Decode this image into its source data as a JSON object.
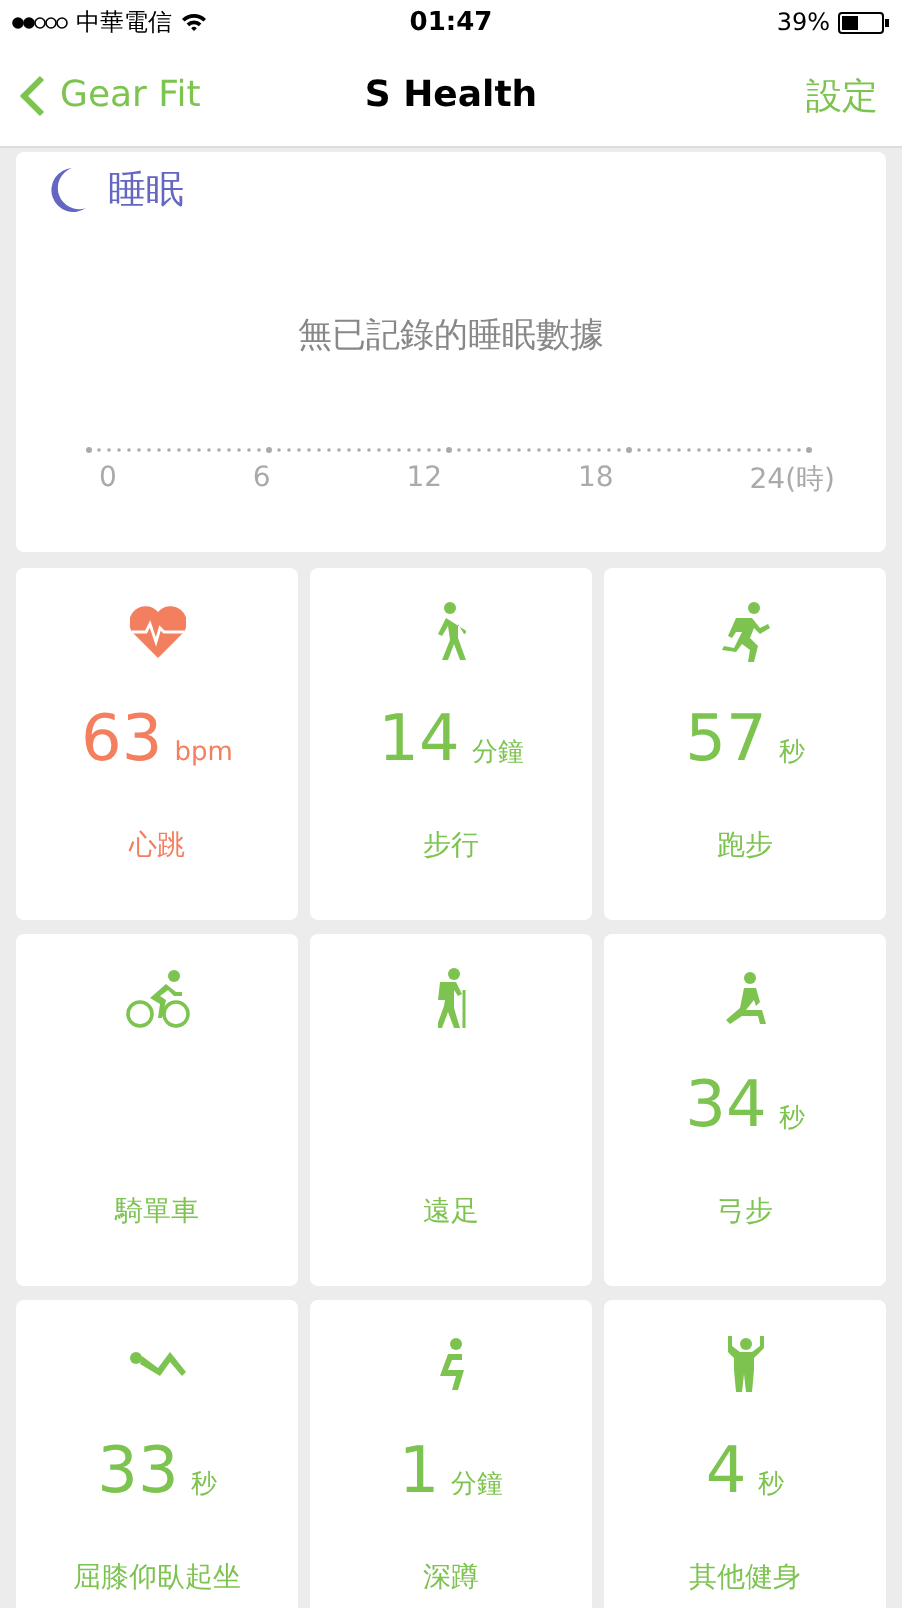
{
  "status_bar": {
    "carrier": "中華電信",
    "time": "01:47",
    "battery": "39%"
  },
  "nav": {
    "back": "Gear Fit",
    "title": "S Health",
    "action": "設定"
  },
  "sleep": {
    "title": "睡眠",
    "message": "無已記錄的睡眠數據",
    "axis_labels": [
      "0",
      "6",
      "12",
      "18",
      "24(時)"
    ]
  },
  "tile_rows": [
    [
      {
        "kind": "heart",
        "value": "63",
        "unit": "bpm",
        "label": "心跳"
      },
      {
        "kind": "walk",
        "value": "14",
        "unit": "分鐘",
        "label": "步行"
      },
      {
        "kind": "run",
        "value": "57",
        "unit": "秒",
        "label": "跑步"
      }
    ],
    [
      {
        "kind": "bike",
        "label": "騎單車"
      },
      {
        "kind": "hike",
        "label": "遠足"
      },
      {
        "kind": "lunge",
        "value": "34",
        "unit": "秒",
        "label": "弓步"
      }
    ],
    [
      {
        "kind": "situp",
        "value": "33",
        "unit": "秒",
        "label": "屈膝仰臥起坐"
      },
      {
        "kind": "squat",
        "value": "1",
        "unit": "分鐘",
        "label": "深蹲"
      },
      {
        "kind": "strength",
        "value": "4",
        "unit": "秒",
        "label": "其他健身"
      }
    ]
  ]
}
